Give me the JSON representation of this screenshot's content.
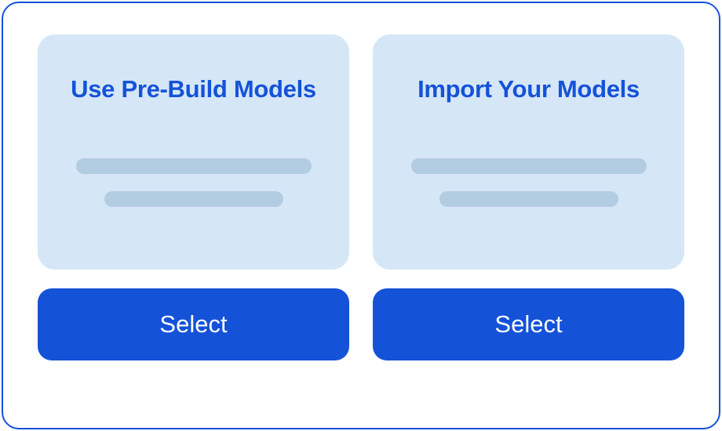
{
  "options": [
    {
      "title": "Use Pre-Build Models",
      "button_label": "Select"
    },
    {
      "title": "Import Your Models",
      "button_label": "Select"
    }
  ]
}
